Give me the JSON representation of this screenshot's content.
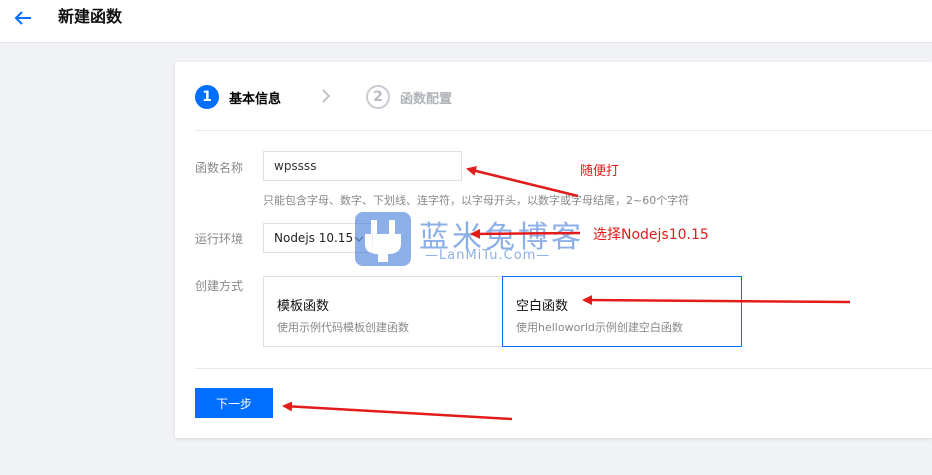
{
  "header": {
    "back_icon": "arrow-left-icon",
    "title": "新建函数"
  },
  "steps": [
    {
      "number": "1",
      "label": "基本信息",
      "state": "active"
    },
    {
      "number": "2",
      "label": "函数配置",
      "state": "inactive"
    }
  ],
  "form": {
    "name": {
      "label": "函数名称",
      "value": "wpssss",
      "hint": "只能包含字母、数字、下划线、连字符，以字母开头，以数字或字母结尾，2~60个字符"
    },
    "runtime": {
      "label": "运行环境",
      "selected": "Nodejs 10.15"
    },
    "creation": {
      "label": "创建方式",
      "options": [
        {
          "title": "模板函数",
          "desc": "使用示例代码模板创建函数",
          "selected": false
        },
        {
          "title": "空白函数",
          "desc": "使用helloworld示例创建空白函数",
          "selected": true
        }
      ]
    }
  },
  "actions": {
    "next_label": "下一步"
  },
  "watermark": {
    "text": "蓝米兔博客",
    "url": "—LanMiTu.Com—"
  },
  "annotations": [
    "随便打",
    "选择Nodejs10.15"
  ],
  "colors": {
    "primary": "#006eff",
    "annotation": "#e21b1b",
    "watermark": "#2f6fd6"
  }
}
